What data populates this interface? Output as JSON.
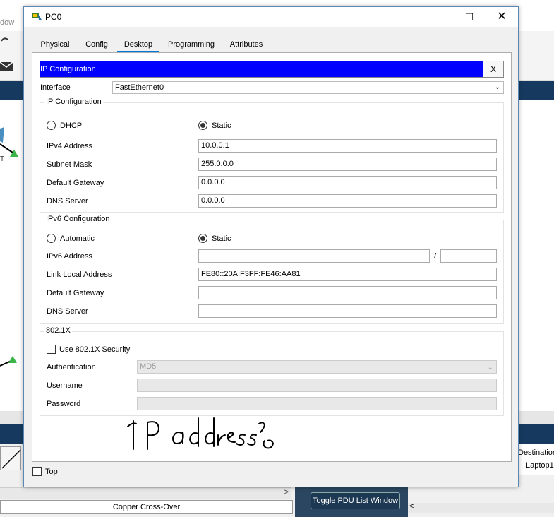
{
  "background": {
    "menu_fragment": "dow",
    "device_label": "T",
    "cable_label": "Copper Cross-Over",
    "toggle_pdu_button": "Toggle PDU List Window",
    "pdu_table": {
      "column": "Destination",
      "cell": "Laptop1"
    }
  },
  "window": {
    "title": "PC0",
    "controls": {
      "minimize": "—",
      "maximize": "☐",
      "close": "✕"
    },
    "tabs": [
      {
        "label": "Physical"
      },
      {
        "label": "Config"
      },
      {
        "label": "Desktop",
        "active": true
      },
      {
        "label": "Programming"
      },
      {
        "label": "Attributes"
      }
    ],
    "top_checkbox_label": "Top"
  },
  "ip_config": {
    "header": "IP Configuration",
    "close": "X",
    "interface_label": "Interface",
    "interface_value": "FastEthernet0",
    "ipv4": {
      "group_title": "IP Configuration",
      "dhcp_label": "DHCP",
      "static_label": "Static",
      "selected": "Static",
      "ipv4_address_label": "IPv4 Address",
      "ipv4_address": "10.0.0.1",
      "subnet_mask_label": "Subnet Mask",
      "subnet_mask": "255.0.0.0",
      "gateway_label": "Default Gateway",
      "gateway": "0.0.0.0",
      "dns_label": "DNS Server",
      "dns": "0.0.0.0"
    },
    "ipv6": {
      "group_title": "IPv6 Configuration",
      "automatic_label": "Automatic",
      "static_label": "Static",
      "selected": "Static",
      "address_label": "IPv6 Address",
      "address": "",
      "prefix_sep": "/",
      "prefix": "",
      "link_local_label": "Link Local Address",
      "link_local": "FE80::20A:F3FF:FE46:AA81",
      "gateway_label": "Default Gateway",
      "gateway": "",
      "dns_label": "DNS Server",
      "dns": ""
    },
    "dot1x": {
      "group_title": "802.1X",
      "use_label": "Use 802.1X Security",
      "auth_label": "Authentication",
      "auth_value": "MD5",
      "username_label": "Username",
      "password_label": "Password"
    }
  },
  "handwritten_note": "IP address?"
}
